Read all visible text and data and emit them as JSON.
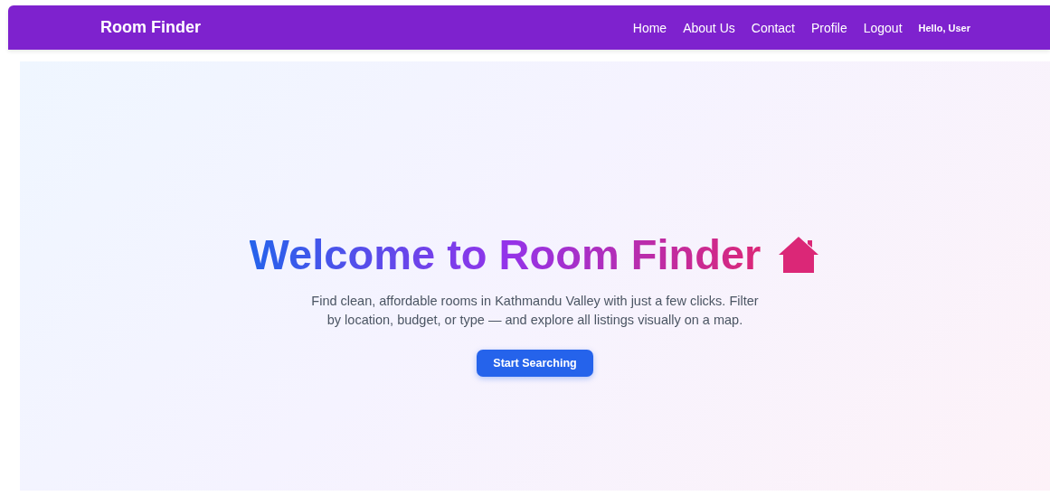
{
  "navbar": {
    "brand": "Room Finder",
    "links": [
      {
        "label": "Home"
      },
      {
        "label": "About Us"
      },
      {
        "label": "Contact"
      },
      {
        "label": "Profile"
      },
      {
        "label": "Logout"
      }
    ],
    "greeting": "Hello, User"
  },
  "hero": {
    "title": "Welcome to Room Finder",
    "description": "Find clean, affordable rooms in Kathmandu Valley with just a few clicks. Filter by location, budget, or type — and explore all listings visually on a map.",
    "button": "Start Searching"
  }
}
